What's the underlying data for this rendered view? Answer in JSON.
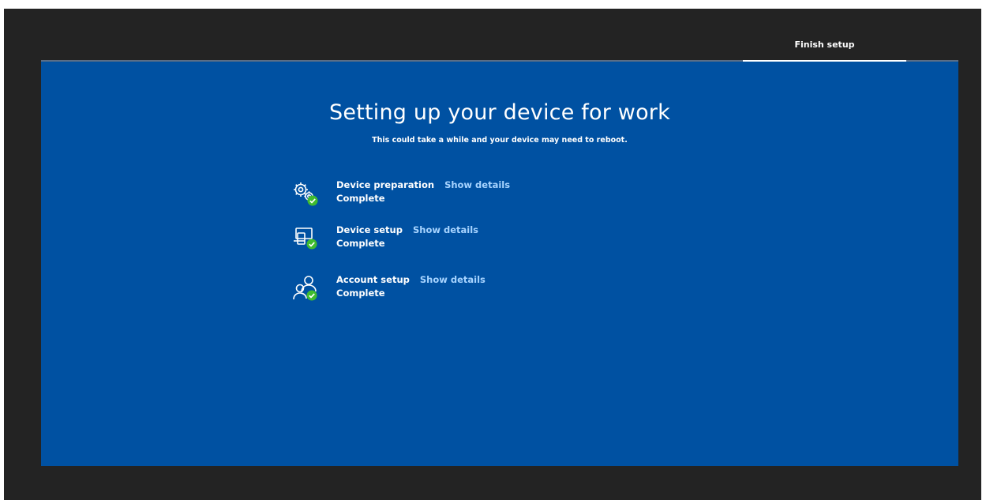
{
  "header": {
    "active_tab": "Finish setup"
  },
  "main": {
    "title": "Setting up your device for work",
    "subtitle": "This could take a while and your device may need to reboot."
  },
  "steps": [
    {
      "title": "Device preparation",
      "link": "Show details",
      "status": "Complete",
      "icon": "gears-icon"
    },
    {
      "title": "Device setup",
      "link": "Show details",
      "status": "Complete",
      "icon": "devices-icon"
    },
    {
      "title": "Account setup",
      "link": "Show details",
      "status": "Complete",
      "icon": "people-icon"
    }
  ],
  "colors": {
    "background": "#0051a2",
    "frame": "#232323",
    "link": "#a7d4ff",
    "check": "#3fbb2f"
  }
}
